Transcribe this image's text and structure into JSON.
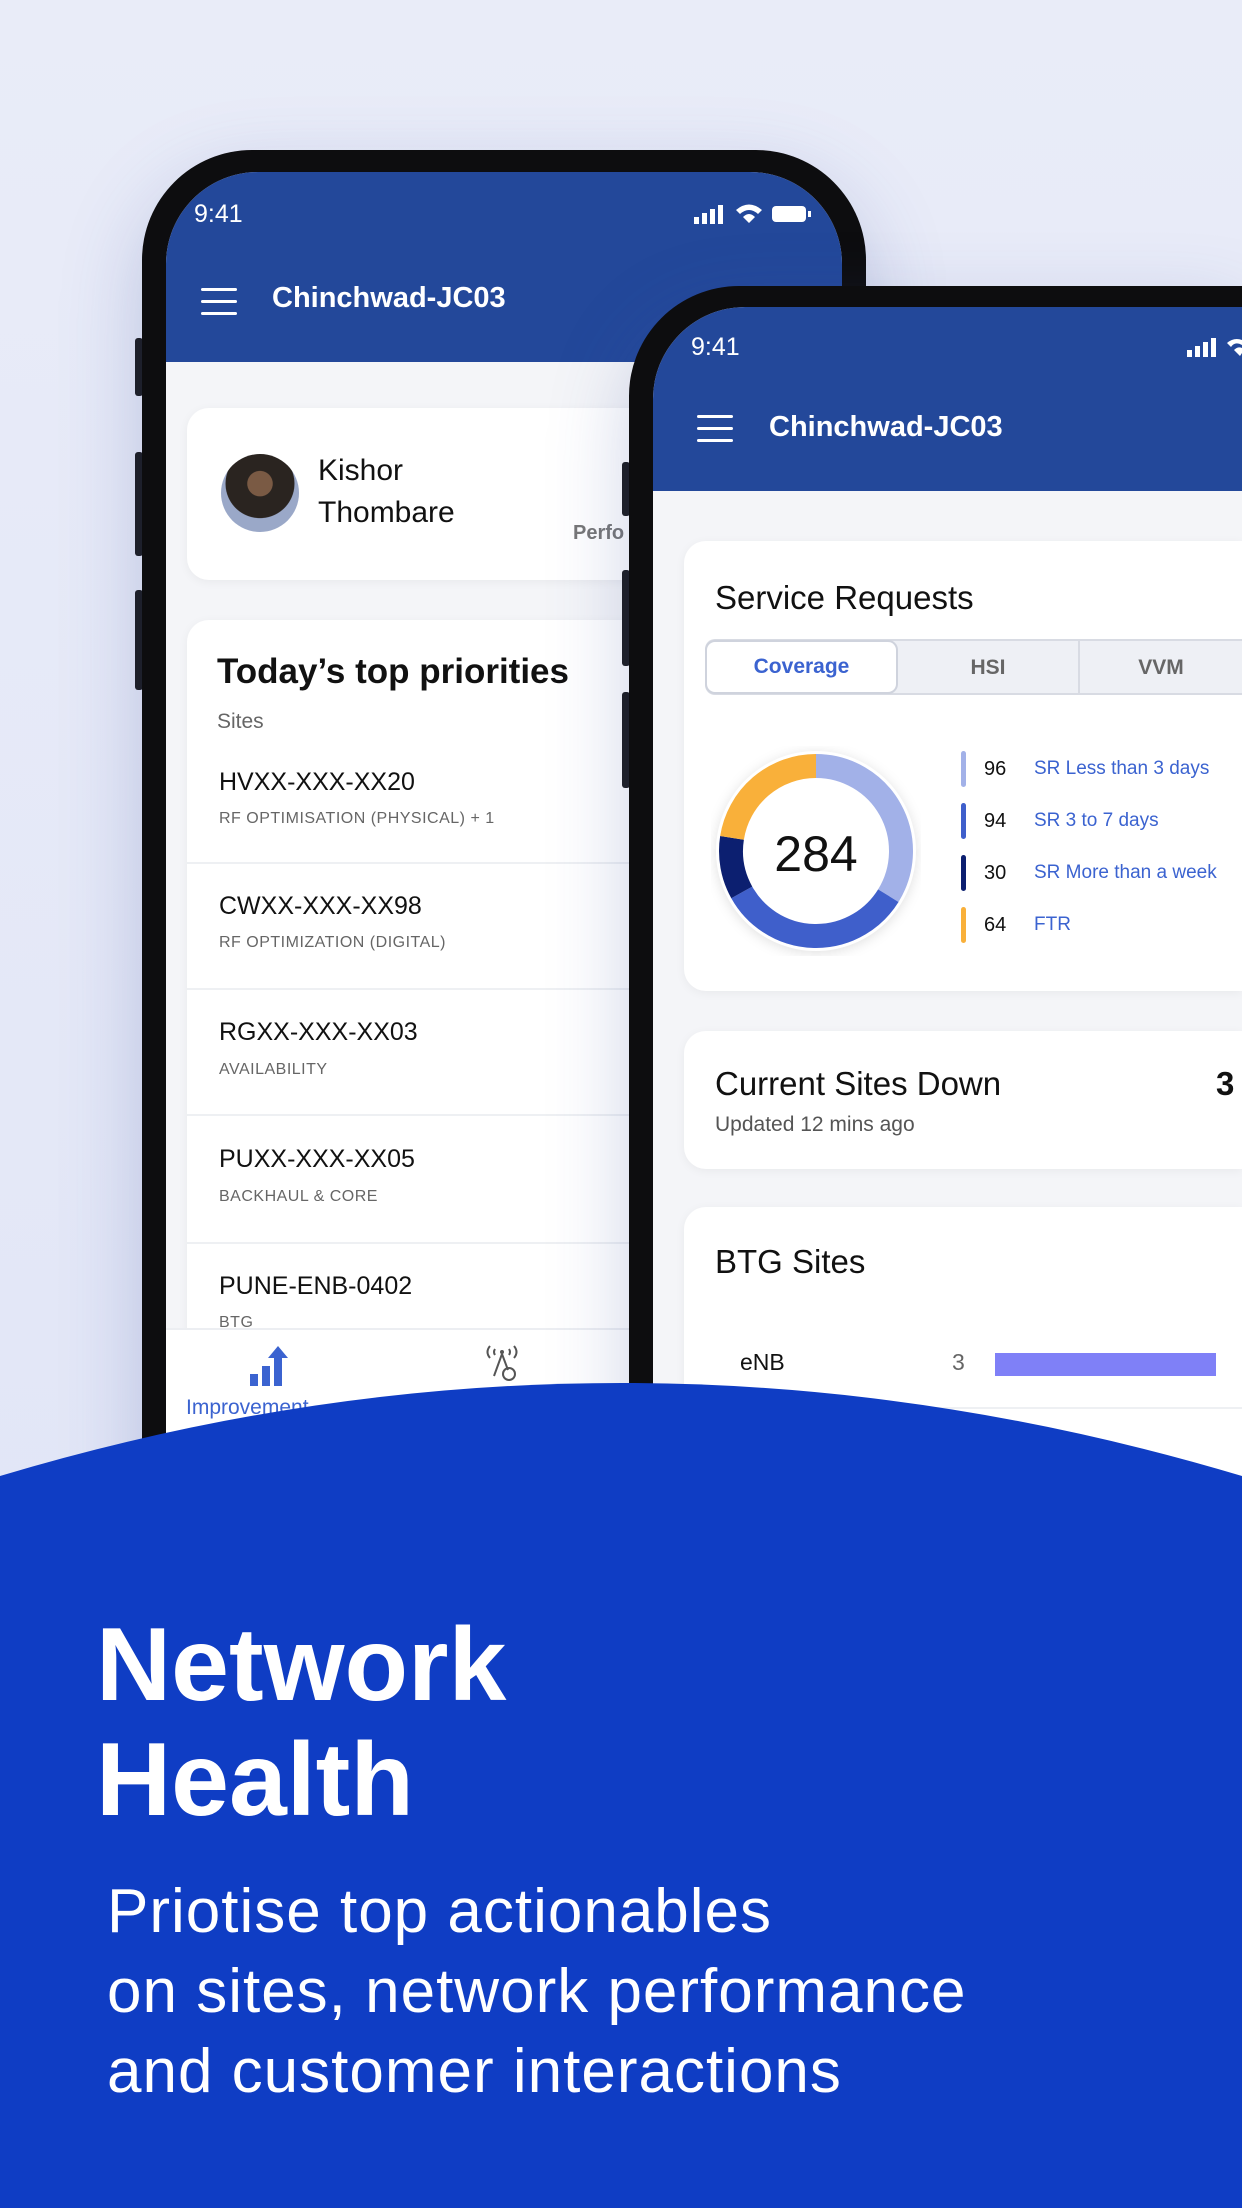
{
  "colors": {
    "header": "#23489a",
    "wave": "#0f3dc4",
    "donut": [
      "#a2b1e8",
      "#3f5fcb",
      "#0c1f70",
      "#f9b03a"
    ],
    "btg_bar": "#7f80f7"
  },
  "phone_left": {
    "status": {
      "time": "9:41",
      "icons": [
        "signal-icon",
        "wifi-icon",
        "battery-icon"
      ]
    },
    "header": {
      "title": "Chinchwad-JC03",
      "menu_icon": "hamburger-icon"
    },
    "user": {
      "first_name": "Kishor",
      "last_name": "Thombare",
      "partial_label": "Perfo"
    },
    "priorities": {
      "title": "Today’s top priorities",
      "subtitle": "Sites",
      "items": [
        {
          "code": "HVXX-XXX-XX20",
          "type": "RF OPTIMISATION (PHYSICAL) + 1"
        },
        {
          "code": "CWXX-XXX-XX98",
          "type": "RF OPTIMIZATION (DIGITAL)"
        },
        {
          "code": "RGXX-XXX-XX03",
          "type": "AVAILABILITY"
        },
        {
          "code": "PUXX-XXX-XX05",
          "type": "BACKHAUL & CORE"
        },
        {
          "code": "PUNE-ENB-0402",
          "type": "BTG"
        }
      ]
    },
    "bottom_nav": [
      {
        "label": "Improvement",
        "icon": "chart-up-icon",
        "active": true
      },
      {
        "label": "",
        "icon": "tower-icon",
        "active": false
      }
    ]
  },
  "phone_right": {
    "status": {
      "time": "9:41"
    },
    "header": {
      "title": "Chinchwad-JC03"
    },
    "service_requests": {
      "title": "Service Requests",
      "tabs": [
        {
          "label": "Coverage",
          "active": true
        },
        {
          "label": "HSI",
          "active": false
        },
        {
          "label": "VVM",
          "active": false
        }
      ],
      "total": "284",
      "legend": [
        {
          "value": 96,
          "label": "SR Less than 3 days"
        },
        {
          "value": 94,
          "label": "SR 3 to 7 days"
        },
        {
          "value": 30,
          "label": "SR More than a week"
        },
        {
          "value": 64,
          "label": "FTR"
        }
      ]
    },
    "sites_down": {
      "title": "Current Sites Down",
      "updated": "Updated 12 mins ago",
      "count": "3"
    },
    "btg": {
      "title": "BTG Sites",
      "rows": [
        {
          "label": "eNB",
          "value": "3"
        }
      ]
    }
  },
  "hero": {
    "title_line1": "Network",
    "title_line2": "Health",
    "subtitle_lines": [
      "Priotise top actionables",
      "on sites, network performance",
      "and customer interactions"
    ]
  }
}
